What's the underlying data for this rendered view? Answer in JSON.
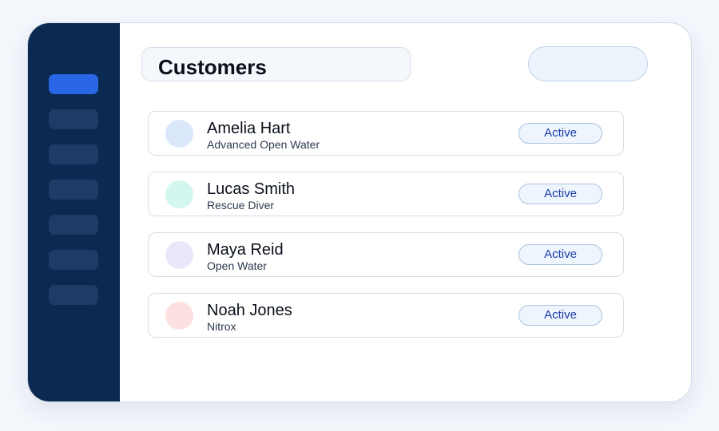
{
  "page": {
    "title": "Customers"
  },
  "sidebar": {
    "items": [
      {
        "name": "nav-item-1",
        "active": true
      },
      {
        "name": "nav-item-2",
        "active": false
      },
      {
        "name": "nav-item-3",
        "active": false
      },
      {
        "name": "nav-item-4",
        "active": false
      },
      {
        "name": "nav-item-5",
        "active": false
      },
      {
        "name": "nav-item-6",
        "active": false
      },
      {
        "name": "nav-item-7",
        "active": false
      }
    ]
  },
  "customers": [
    {
      "name": "Amelia Hart",
      "certification": "Advanced Open Water",
      "status": "Active",
      "avatar_color": "#dbe8fc"
    },
    {
      "name": "Lucas Smith",
      "certification": "Rescue Diver",
      "status": "Active",
      "avatar_color": "#d3f7ee"
    },
    {
      "name": "Maya Reid",
      "certification": "Open Water",
      "status": "Active",
      "avatar_color": "#e9e8fb"
    },
    {
      "name": "Noah Jones",
      "certification": "Nitrox",
      "status": "Active",
      "avatar_color": "#fde0e0"
    }
  ],
  "colors": {
    "sidebar_bg": "#0b2a52",
    "nav_active": "#2a67e6",
    "nav_idle": "#1d3b66",
    "status_text": "#1b3aa8"
  }
}
